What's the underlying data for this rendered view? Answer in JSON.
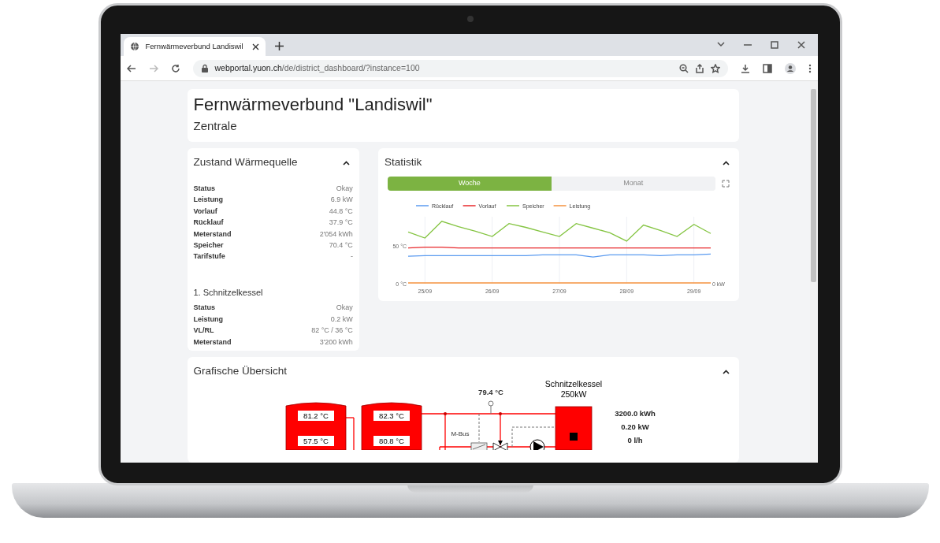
{
  "browser": {
    "tab_title": "Fernwärmeverbund Landiswil",
    "url_host": "webportal.yuon.ch",
    "url_path": "/de/district_dashboard/?instance=100"
  },
  "header": {
    "title": "Fernwärmeverbund \"Landiswil\"",
    "subtitle": "Zentrale"
  },
  "heat_source": {
    "title": "Zustand Wärmequelle",
    "rows": [
      {
        "label": "Status",
        "value": "Okay"
      },
      {
        "label": "Leistung",
        "value": "6.9 kW"
      },
      {
        "label": "Vorlauf",
        "value": "44.8 °C"
      },
      {
        "label": "Rücklauf",
        "value": "37.9 °C"
      },
      {
        "label": "Meterstand",
        "value": "2'054 kWh"
      },
      {
        "label": "Speicher",
        "value": "70.4 °C"
      },
      {
        "label": "Tarifstufe",
        "value": "-"
      }
    ],
    "boiler": {
      "title": "1. Schnitzelkessel",
      "rows": [
        {
          "label": "Status",
          "value": "Okay"
        },
        {
          "label": "Leistung",
          "value": "0.2 kW"
        },
        {
          "label": "VL/RL",
          "value": "82 °C / 36 °C"
        },
        {
          "label": "Meterstand",
          "value": "3'200 kWh"
        }
      ]
    }
  },
  "statistics": {
    "title": "Statistik",
    "tabs": [
      {
        "label": "Woche",
        "selected": true
      },
      {
        "label": "Monat",
        "selected": false
      }
    ],
    "chart_data": {
      "type": "line",
      "categories": [
        null,
        "25/09",
        null,
        null,
        null,
        "26/09",
        null,
        null,
        null,
        "27/09",
        null,
        null,
        null,
        "28/09",
        null,
        null,
        null,
        "29/09",
        null
      ],
      "ylim": [
        0,
        88
      ],
      "yticks": [
        {
          "value": 0,
          "label": "0 °C"
        },
        {
          "value": 50,
          "label": "50 °C"
        }
      ],
      "annotations": [
        "0 kW"
      ],
      "grid": true,
      "legend": "top",
      "series": [
        {
          "name": "Rücklauf",
          "color": "#5b9bf0",
          "values": [
            36,
            37,
            37,
            37,
            37,
            37,
            37,
            37,
            38,
            38,
            38,
            35,
            38,
            38,
            38,
            37,
            38,
            38,
            39
          ]
        },
        {
          "name": "Vorlauf",
          "color": "#e8282b",
          "values": [
            47,
            48,
            48,
            47,
            47,
            47,
            47,
            47,
            47,
            47,
            47,
            47,
            47,
            47,
            47,
            47,
            47,
            47,
            47
          ]
        },
        {
          "name": "Speicher",
          "color": "#84c441",
          "values": [
            68,
            60,
            82,
            75,
            69,
            62,
            79,
            74,
            68,
            62,
            79,
            73,
            67,
            56,
            77,
            70,
            62,
            78,
            66
          ]
        },
        {
          "name": "Leistung",
          "color": "#f5923e",
          "values": [
            1,
            1,
            1,
            1,
            1,
            1,
            1,
            1,
            1,
            1,
            1,
            1,
            1,
            1,
            1,
            1,
            1,
            1,
            1
          ]
        }
      ]
    }
  },
  "overview": {
    "title": "Grafische Übersicht",
    "diagram": {
      "tanks": [
        {
          "top": "81.2 °C",
          "bottom": "57.5 °C"
        },
        {
          "top": "82.3 °C",
          "bottom": "80.8 °C"
        }
      ],
      "sensor": "79.4 °C",
      "meter_label": "M-Bus",
      "boiler_name": "Schnitzelkessel",
      "boiler_power": "250kW",
      "readings": [
        "3200.0 kWh",
        "0.20 kW",
        "0 l/h"
      ]
    }
  }
}
